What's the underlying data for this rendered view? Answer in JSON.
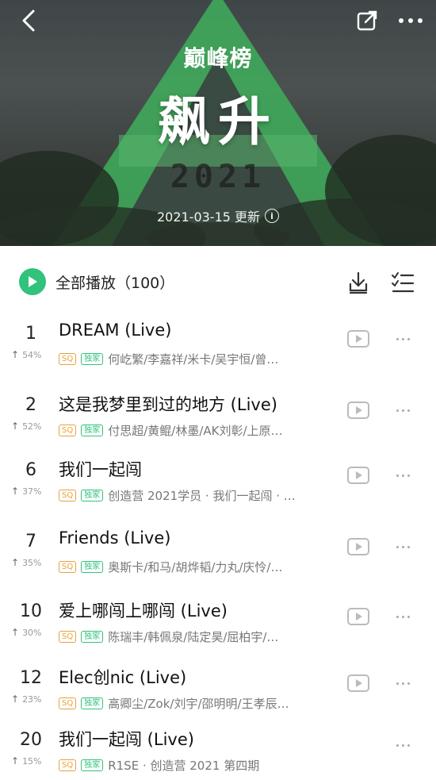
{
  "header": {
    "brand": "巅峰榜",
    "title": "飙升",
    "year": "2021",
    "update_text": "2021-03-15 更新",
    "info_icon": "info-icon"
  },
  "toolbar": {
    "play_all_label": "全部播放（100）",
    "download_icon": "download-icon",
    "multi_select_icon": "multi-select-icon"
  },
  "colors": {
    "accent_green": "#31c27c",
    "sq_badge": "#e8a23b"
  },
  "songs": [
    {
      "rank": "1",
      "trend": "54%",
      "title": "DREAM (Live)",
      "sq": "SQ",
      "exclusive": "独家",
      "artists": "何屹繁/李嘉祥/米卡/吴宇恒/曾…",
      "has_mv": true
    },
    {
      "rank": "2",
      "trend": "52%",
      "title": "这是我梦里到过的地方 (Live)",
      "sq": "SQ",
      "exclusive": "独家",
      "artists": "付思超/黄鲲/林墨/AK刘彰/上原…",
      "has_mv": true
    },
    {
      "rank": "6",
      "trend": "37%",
      "title": "我们一起闯",
      "sq": "SQ",
      "exclusive": "独家",
      "artists": "创造营 2021学员 · 我们一起闯 · …",
      "has_mv": true
    },
    {
      "rank": "7",
      "trend": "35%",
      "title": "Friends (Live)",
      "sq": "SQ",
      "exclusive": "独家",
      "artists": "奥斯卡/和马/胡烨韬/力丸/庆怜/…",
      "has_mv": true
    },
    {
      "rank": "10",
      "trend": "30%",
      "title": "爱上哪闯上哪闯 (Live)",
      "sq": "SQ",
      "exclusive": "独家",
      "artists": "陈瑞丰/韩佩泉/陆定昊/屈柏宇/…",
      "has_mv": true
    },
    {
      "rank": "12",
      "trend": "23%",
      "title": "Elec创nic (Live)",
      "sq": "SQ",
      "exclusive": "独家",
      "artists": "高卿尘/Zok/刘宇/邵明明/王孝辰…",
      "has_mv": true
    },
    {
      "rank": "20",
      "trend": "15%",
      "title": "我们一起闯 (Live)",
      "sq": "SQ",
      "exclusive": "独家",
      "artists": "R1SE · 创造营 2021 第四期",
      "has_mv": false
    }
  ]
}
